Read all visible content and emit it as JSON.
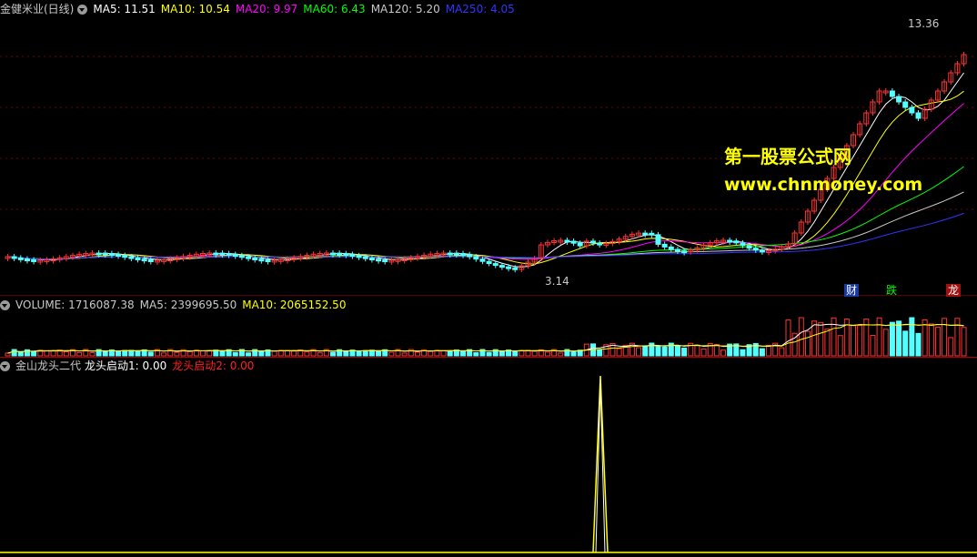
{
  "main": {
    "stock_title": "金健米业(日线)",
    "ma": [
      {
        "label": "MA5: 11.51",
        "color": "#ffffff"
      },
      {
        "label": "MA10: 10.54",
        "color": "#ffff00"
      },
      {
        "label": "MA20: 9.97",
        "color": "#ff00ff"
      },
      {
        "label": "MA60: 6.43",
        "color": "#00ff00"
      },
      {
        "label": "MA120: 5.20",
        "color": "#c8c8c8"
      },
      {
        "label": "MA250: 4.05",
        "color": "#3333ff"
      }
    ],
    "high_label": "13.36",
    "low_label": "3.14",
    "badges": {
      "cai": "财",
      "die": "跌",
      "long": "龙"
    },
    "watermark_line1": "第一股票公式网",
    "watermark_line2": "www.chnmoney.com"
  },
  "volume": {
    "label": "VOLUME: 1716087.38",
    "ma5": "MA5: 2399695.50",
    "ma10": "MA10: 2065152.50"
  },
  "indicator": {
    "name": "金山龙头二代",
    "s1": "龙头启动1: 0.00",
    "s2": "龙头启动2: 0.00"
  },
  "colors": {
    "up": "#ff3232",
    "down": "#54ffff",
    "grid": "#8b0000"
  }
}
